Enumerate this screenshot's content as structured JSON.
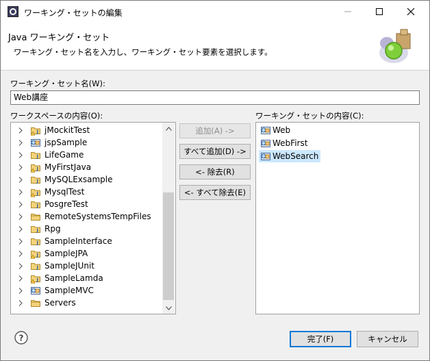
{
  "window": {
    "title": "ワーキング・セットの編集"
  },
  "header": {
    "title": "Java ワーキング・セット",
    "description": "ワーキング・セット名を入力し、ワーキング・セット要素を選択します。"
  },
  "name_field": {
    "label": "ワーキング・セット名(W):",
    "value": "Web講座"
  },
  "workspace": {
    "label": "ワークスペースの内容(O):",
    "items": [
      {
        "label": "jMockitTest",
        "icon": "java-project-warning-icon"
      },
      {
        "label": "jspSample",
        "icon": "web-project-icon"
      },
      {
        "label": "LifeGame",
        "icon": "java-project-icon"
      },
      {
        "label": "MyFirstJava",
        "icon": "java-project-warning-icon"
      },
      {
        "label": "MySQLExsample",
        "icon": "java-project-icon"
      },
      {
        "label": "MysqlTest",
        "icon": "java-project-warning-icon"
      },
      {
        "label": "PosgreTest",
        "icon": "java-project-icon"
      },
      {
        "label": "RemoteSystemsTempFiles",
        "icon": "folder-project-icon"
      },
      {
        "label": "Rpg",
        "icon": "java-project-icon"
      },
      {
        "label": "SampleInterface",
        "icon": "java-project-icon"
      },
      {
        "label": "SampleJPA",
        "icon": "java-project-warning-icon"
      },
      {
        "label": "SampleJUnit",
        "icon": "java-project-icon"
      },
      {
        "label": "SampleLamda",
        "icon": "java-project-warning-icon"
      },
      {
        "label": "SampleMVC",
        "icon": "web-project-icon"
      },
      {
        "label": "Servers",
        "icon": "folder-project-icon"
      }
    ]
  },
  "buttons": {
    "add": "追加(A) ->",
    "add_all": "すべて追加(D) ->",
    "remove": "<- 除去(R)",
    "remove_all": "<- すべて除去(E)",
    "finish": "完了(F)",
    "cancel": "キャンセル"
  },
  "working_set": {
    "label": "ワーキング・セットの内容(C):",
    "items": [
      {
        "label": "Web",
        "icon": "web-project-icon"
      },
      {
        "label": "WebFirst",
        "icon": "web-project-icon"
      },
      {
        "label": "WebSearch",
        "icon": "web-project-icon",
        "selected": true
      }
    ]
  },
  "colors": {
    "selection": "#cce8ff",
    "default_button_border": "#0078d7",
    "dialog_background": "#f0f0f0"
  }
}
